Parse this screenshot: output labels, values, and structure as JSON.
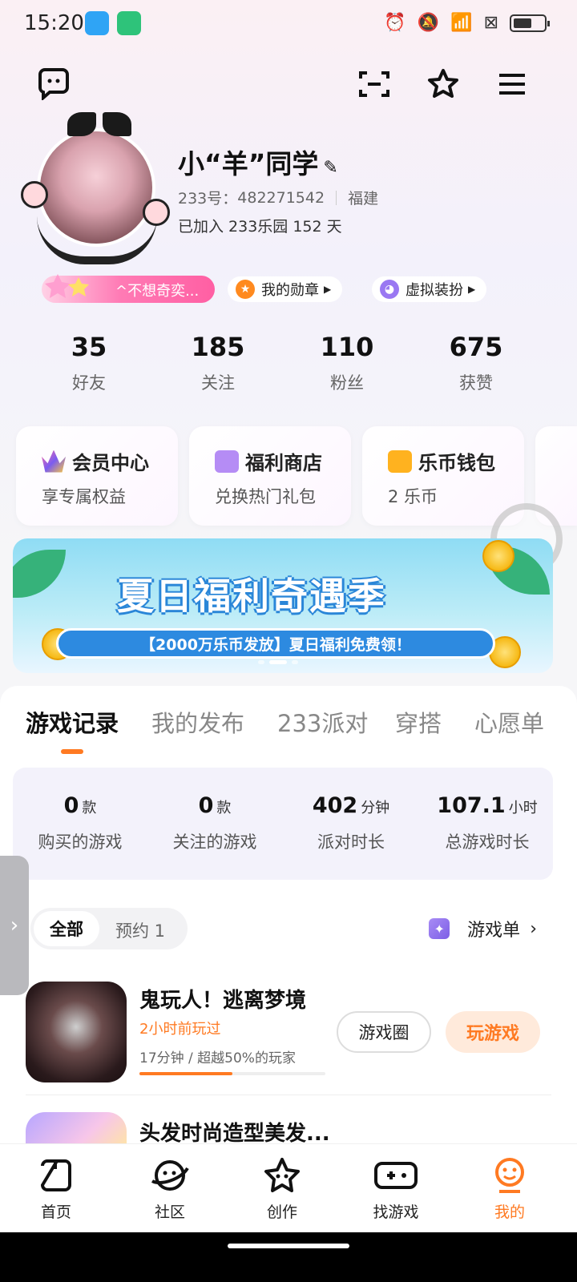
{
  "status_bar": {
    "time": "15:20"
  },
  "profile": {
    "name": "小“羊”同学",
    "id_label": "233号：",
    "id_value": "482271542",
    "location": "福建",
    "joined": "已加入 233乐园 152 天"
  },
  "chips": {
    "signature": "^不想奇奕...",
    "medals": "我的勋章",
    "avatar_outfit": "虚拟装扮"
  },
  "stats": [
    {
      "value": "35",
      "label": "好友"
    },
    {
      "value": "185",
      "label": "关注"
    },
    {
      "value": "110",
      "label": "粉丝"
    },
    {
      "value": "675",
      "label": "获赞"
    }
  ],
  "cards": [
    {
      "title": "会员中心",
      "subtitle": "享专属权益",
      "color": "#7a5cf0"
    },
    {
      "title": "福利商店",
      "subtitle": "兑换热门礼包",
      "color": "#b58cf5"
    },
    {
      "title": "乐币钱包",
      "subtitle": "2 乐币",
      "color": "#ffb21f"
    }
  ],
  "banner": {
    "headline": "夏日福利奇遇季",
    "tagline": "【2000万乐币发放】夏日福利免费领！"
  },
  "tabs": [
    "游戏记录",
    "我的发布",
    "233派对",
    "穿搭",
    "心愿单"
  ],
  "game_stats": [
    {
      "value": "0",
      "unit": "款",
      "label": "购买的游戏"
    },
    {
      "value": "0",
      "unit": "款",
      "label": "关注的游戏"
    },
    {
      "value": "402",
      "unit": "分钟",
      "label": "派对时长"
    },
    {
      "value": "107.1",
      "unit": "小时",
      "label": "总游戏时长"
    }
  ],
  "filter": {
    "all": "全部",
    "reserve": "预约 1",
    "game_list": "游戏单"
  },
  "games": [
    {
      "name": "鬼玩人！逃离梦境",
      "last_played": "2小时前玩过",
      "meta": "17分钟 / 超越50%的玩家",
      "progress": 0.5,
      "circle_btn": "游戏圈",
      "play_btn": "玩游戏"
    },
    {
      "name": "头发时尚造型美发..."
    }
  ],
  "nav": [
    {
      "label": "首页",
      "icon": "home-icon"
    },
    {
      "label": "社区",
      "icon": "planet-icon"
    },
    {
      "label": "创作",
      "icon": "star-icon"
    },
    {
      "label": "找游戏",
      "icon": "gamepad-icon"
    },
    {
      "label": "我的",
      "icon": "profile-icon"
    }
  ],
  "accent_color": "#ff7a22"
}
